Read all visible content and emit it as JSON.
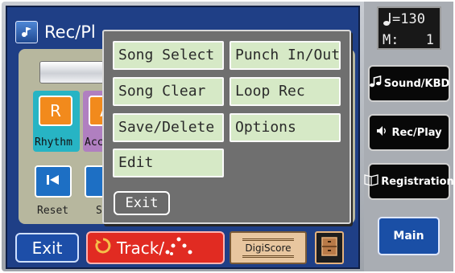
{
  "screen": {
    "title": "Rec/Pl",
    "parts": [
      {
        "key": "R",
        "label": "Rhythm",
        "color": "#f28a1c",
        "bg": "#27b4c4"
      },
      {
        "key": "A",
        "label": "Acc",
        "color": "#f28a1c",
        "bg": "#b07fc0"
      }
    ],
    "transport": [
      {
        "label": "Reset"
      },
      {
        "label": "S"
      }
    ]
  },
  "popup": {
    "menu": [
      {
        "label": "Song Select"
      },
      {
        "label": "Punch In/Out"
      },
      {
        "label": "Song Clear"
      },
      {
        "label": "Loop Rec"
      },
      {
        "label": "Save/Delete"
      },
      {
        "label": "Options"
      },
      {
        "label": "Edit"
      }
    ],
    "exit_label": "Exit"
  },
  "bottom_bar": {
    "exit_label": "Exit",
    "track_label": "Track/",
    "digiscore_label": "DigiScore"
  },
  "sidebar": {
    "tempo_value": "=130",
    "measure_label": "M:",
    "measure_value": "1",
    "buttons": [
      {
        "label": "Sound/KBD",
        "icon": "music-notes-icon"
      },
      {
        "label": "Rec/Play",
        "icon": "speaker-icon"
      },
      {
        "label": "Registration",
        "icon": "book-icon"
      }
    ],
    "main_label": "Main"
  },
  "colors": {
    "screen_blue": "#1f3f86",
    "menu_green": "#d6e9c6",
    "track_red": "#e12b22",
    "digiscore_tan": "#e8c69f",
    "main_blue": "#1a4fa6"
  }
}
